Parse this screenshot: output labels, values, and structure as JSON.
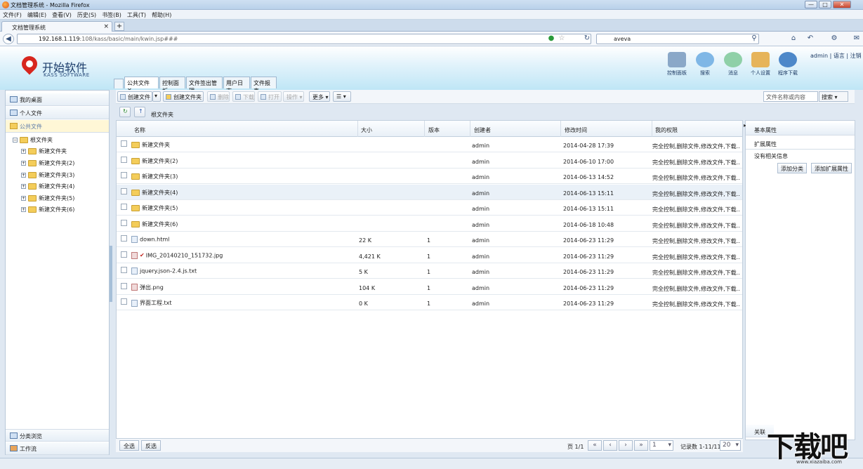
{
  "window": {
    "title": "文档管理系统 - Mozilla Firefox",
    "min": "—",
    "max": "□",
    "close": "✕"
  },
  "menu": [
    "文件(F)",
    "编辑(E)",
    "查看(V)",
    "历史(S)",
    "书签(B)",
    "工具(T)",
    "帮助(H)"
  ],
  "browser_tab": {
    "title": "文档管理系统",
    "close": "×",
    "new": "+"
  },
  "address": {
    "host": "192.168.1.119",
    "path": ":108/kass/basic/main/kwin.jsp###"
  },
  "search": {
    "value": "aveva"
  },
  "app": {
    "logo_name": "开始软件",
    "logo_sub": "KASS SOFTWARE",
    "toolbar": [
      {
        "label": "控制面板",
        "color": "#8aa8c8"
      },
      {
        "label": "搜索",
        "color": "#7fb7e6"
      },
      {
        "label": "消息",
        "color": "#8fd0a8"
      },
      {
        "label": "个人设置",
        "color": "#e6b45a"
      },
      {
        "label": "程序下载",
        "color": "#4d88c9"
      }
    ],
    "user": "admin",
    "lang": "语言",
    "logout": "注销"
  },
  "module_tabs": [
    "公共文件",
    "控制面板",
    "文件签出管理",
    "用户日志",
    "文件报表"
  ],
  "tab_close": "✕",
  "left_nav": {
    "items": [
      "我的桌面",
      "个人文件",
      "公共文件"
    ],
    "tree_root": "根文件夹",
    "tree_children": [
      "新建文件夹",
      "新建文件夹(2)",
      "新建文件夹(3)",
      "新建文件夹(4)",
      "新建文件夹(5)",
      "新建文件夹(6)"
    ],
    "bottom": [
      "分类浏览",
      "工作流"
    ]
  },
  "toolbar": {
    "create_file": "创建文件",
    "create_folder": "创建文件夹",
    "disabled": [
      "删除",
      "下载",
      "打开",
      "操作"
    ],
    "more": "更多",
    "search_placeholder": "文件名称或内容",
    "search_button": "搜索"
  },
  "breadcrumb": "根文件夹",
  "columns": [
    "名称",
    "大小",
    "版本",
    "创建者",
    "修改时间",
    "我的权限"
  ],
  "rows": [
    {
      "name": "新建文件夹",
      "size": "",
      "version": "",
      "creator": "admin",
      "modified": "2014-04-28 17:39",
      "perm": "完全控制,删除文件,修改文件,下载..",
      "type": "folder"
    },
    {
      "name": "新建文件夹(2)",
      "size": "",
      "version": "",
      "creator": "admin",
      "modified": "2014-06-10 17:00",
      "perm": "完全控制,删除文件,修改文件,下载..",
      "type": "folder"
    },
    {
      "name": "新建文件夹(3)",
      "size": "",
      "version": "",
      "creator": "admin",
      "modified": "2014-06-13 14:52",
      "perm": "完全控制,删除文件,修改文件,下载..",
      "type": "folder"
    },
    {
      "name": "新建文件夹(4)",
      "size": "",
      "version": "",
      "creator": "admin",
      "modified": "2014-06-13 15:11",
      "perm": "完全控制,删除文件,修改文件,下载..",
      "type": "folder"
    },
    {
      "name": "新建文件夹(5)",
      "size": "",
      "version": "",
      "creator": "admin",
      "modified": "2014-06-13 15:11",
      "perm": "完全控制,删除文件,修改文件,下载..",
      "type": "folder"
    },
    {
      "name": "新建文件夹(6)",
      "size": "",
      "version": "",
      "creator": "admin",
      "modified": "2014-06-18 10:48",
      "perm": "完全控制,删除文件,修改文件,下载..",
      "type": "folder"
    },
    {
      "name": "down.html",
      "size": "22 K",
      "version": "1",
      "creator": "admin",
      "modified": "2014-06-23 11:29",
      "perm": "完全控制,删除文件,修改文件,下载..",
      "type": "file"
    },
    {
      "name": "IMG_20140210_151732.jpg",
      "size": "4,421 K",
      "version": "1",
      "creator": "admin",
      "modified": "2014-06-23 11:29",
      "perm": "完全控制,删除文件,修改文件,下载..",
      "type": "img",
      "checked": "✔"
    },
    {
      "name": "jquery.json-2.4.js.txt",
      "size": "5 K",
      "version": "1",
      "creator": "admin",
      "modified": "2014-06-23 11:29",
      "perm": "完全控制,删除文件,修改文件,下载..",
      "type": "file"
    },
    {
      "name": "弹出.png",
      "size": "104 K",
      "version": "1",
      "creator": "admin",
      "modified": "2014-06-23 11:29",
      "perm": "完全控制,删除文件,修改文件,下载..",
      "type": "img"
    },
    {
      "name": "界面工程.txt",
      "size": "0 K",
      "version": "1",
      "creator": "admin",
      "modified": "2014-06-23 11:29",
      "perm": "完全控制,删除文件,修改文件,下载..",
      "type": "file"
    }
  ],
  "right_panel": {
    "basic": "基本属性",
    "ext": "扩展属性",
    "no_info": "没有相关信息",
    "add_category": "添加分类",
    "add_ext": "添加扩展属性",
    "bottom": "关联"
  },
  "footer": {
    "select_all": "全选",
    "invert": "反选",
    "page_label": "页 1/1",
    "page_value": "1",
    "records": "记录数 1-11/11",
    "page_size": "20"
  },
  "watermark": {
    "text": "下载吧",
    "url": "www.xiazaiba.com"
  }
}
